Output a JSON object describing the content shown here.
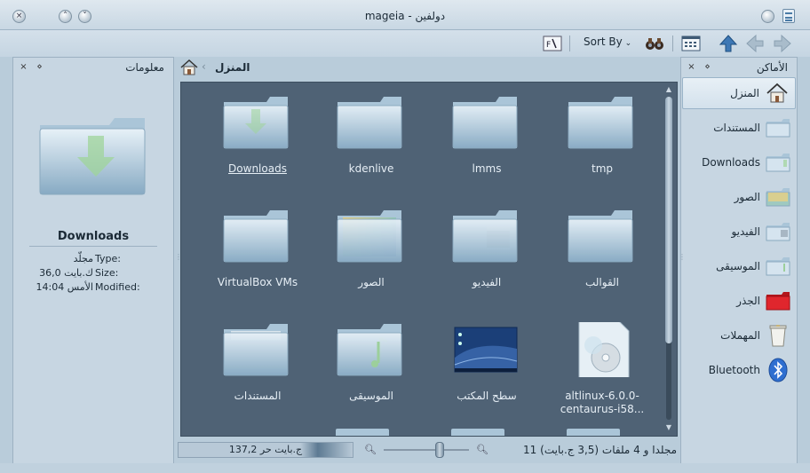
{
  "window": {
    "title": "mageia - دولفين",
    "close_symbol": "×",
    "minimize_symbol": "˅",
    "maximize_symbol": "˄"
  },
  "toolbar": {
    "sort_label": "Sort By",
    "icons": [
      "up-arrow-icon",
      "back-arrow-icon",
      "forward-arrow-icon",
      "view-mode-icon",
      "find-binoculars-icon",
      "rename-icon"
    ]
  },
  "info_panel": {
    "title": "معلومات",
    "name": "Downloads",
    "rows": [
      {
        "key": "Type:",
        "value": "مجلّد"
      },
      {
        "key": "Size:",
        "value": "36,0 ك.بايت"
      },
      {
        "key": "Modified:",
        "value": "الأمس 14:04"
      }
    ]
  },
  "places_panel": {
    "title": "الأماكن",
    "items": [
      {
        "label": "المنزل",
        "icon": "home-icon",
        "active": true
      },
      {
        "label": "المستندات",
        "icon": "folder-documents-icon"
      },
      {
        "label": "Downloads",
        "icon": "folder-downloads-icon"
      },
      {
        "label": "الصور",
        "icon": "folder-pictures-icon"
      },
      {
        "label": "الفيديو",
        "icon": "folder-video-icon"
      },
      {
        "label": "الموسيقى",
        "icon": "folder-music-icon"
      },
      {
        "label": "الجذر",
        "icon": "folder-root-icon"
      },
      {
        "label": "المهملات",
        "icon": "trash-icon"
      },
      {
        "label": "Bluetooth",
        "icon": "bluetooth-icon"
      }
    ]
  },
  "breadcrumb": {
    "label": "المنزل"
  },
  "files": [
    {
      "label": "Downloads",
      "kind": "downloads"
    },
    {
      "label": "kdenlive",
      "kind": "folder"
    },
    {
      "label": "lmms",
      "kind": "folder"
    },
    {
      "label": "tmp",
      "kind": "folder"
    },
    {
      "label": "VirtualBox VMs",
      "kind": "folder"
    },
    {
      "label": "الصور",
      "kind": "pictures"
    },
    {
      "label": "الفيديو",
      "kind": "video"
    },
    {
      "label": "القوالب",
      "kind": "folder"
    },
    {
      "label": "المستندات",
      "kind": "documents"
    },
    {
      "label": "الموسيقى",
      "kind": "music"
    },
    {
      "label": "سطح المكتب",
      "kind": "desktop"
    },
    {
      "label": "altlinux-6.0.0-centaurus-i58...",
      "kind": "disc"
    }
  ],
  "status": {
    "free_space": "137,2 ج.بايت حر",
    "item_count": "11 مجلدا و 4 ملفات (3,5 ج.بايت)"
  },
  "colors": {
    "view_background": "#4f6275",
    "panel_background": "#c7d6e2",
    "folder_light": "#d9e8f3",
    "folder_dark": "#8fb0c8"
  }
}
